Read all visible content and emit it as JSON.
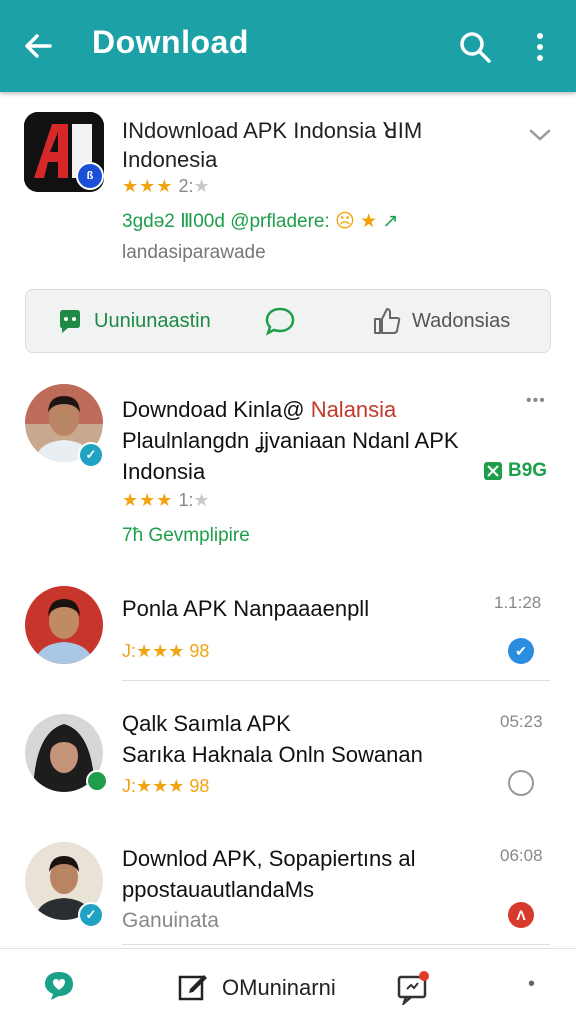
{
  "header": {
    "title": "Download",
    "back_icon": "arrow-left-icon",
    "search_icon": "search-icon",
    "more_icon": "more-vertical-icon",
    "color": "#1ba1a6"
  },
  "app": {
    "title_line1": "INdownload APK Indonsia ꓤIM",
    "title_line2": "Indonesia",
    "stars": "★★★",
    "rating_rest": "2:",
    "rating_empty": "★",
    "meta_text": "3gdə2 Ⅲ00d @prfladere:",
    "subtitle": "landasiparawade"
  },
  "actions": {
    "primary": "Uuniunaastin",
    "secondary": "Wadonsias"
  },
  "items": [
    {
      "title_black": "Downdoad Kinla@",
      "title_red": "Nalansia",
      "line2": "Plaulnlangdn ʝjvaniaan Ndanl APK",
      "line3": "Indonsia",
      "stars": "★★★",
      "rating_rest": "1:",
      "rating_empty": "★",
      "tag": "B9G",
      "green_text": "7ћ Gevmplipire",
      "more": "•••"
    },
    {
      "title": "Ponla APK  Nanpaaaenpll",
      "rating": "J:★★★ 98",
      "time": "1.1:28"
    },
    {
      "title": "Qalk  Saımla APK",
      "line2": "Sarıka Haknala Onln Sowanan",
      "rating": "J:★★★ 98",
      "time": "05:23"
    },
    {
      "title": "Downlod APK, Sopapiertıns al",
      "line2": "ppostauautlandaMs",
      "line3": "Ganuinata",
      "time": "06:08"
    }
  ],
  "bottom_nav": {
    "label": "OMuninarni",
    "dot": "•"
  }
}
